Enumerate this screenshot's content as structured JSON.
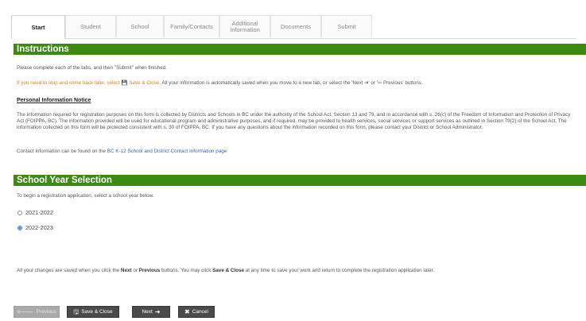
{
  "tabs": [
    {
      "label": "Start",
      "active": true
    },
    {
      "label": "Student",
      "active": false
    },
    {
      "label": "School",
      "active": false
    },
    {
      "label": "Family/Contacts",
      "active": false
    },
    {
      "label": "Additional Information",
      "active": false
    },
    {
      "label": "Documents",
      "active": false
    },
    {
      "label": "Submit",
      "active": false
    }
  ],
  "instructions": {
    "header": "Instructions",
    "line1": "Please complete each of the tabs, and then \"Submit\" when finished.",
    "line2_orange": "If you need to stop and come back later, select",
    "line2_save": "Save & Close",
    "line2_rest": ". All your information is automatically saved when you move to a new tab, or select the 'Next",
    "line2_rest2": "' or '",
    "line2_prev": "Previous' buttons.",
    "notice_title": "Personal Information Notice",
    "notice_body": "The information required for registration purposes on this form is collected by Districts and Schools in BC under the authority of the School Act, Section 13 and 79, and in accordance with s. 26(c) of the Freedom of Information and Protection of Privacy Act (FOIPPA, BC). The information provided will be used for educational program and administrative purposes, and if required, may be provided to health services, social services or support services as outlined in Section 79(2) of the School Act. The information collected on this form will be protected consistent with s. 30 of FOIPPA, BC. If you have any questions about the information recorded on this form, please contact your District or School Administrator.",
    "contact_prefix": "Contact information can be found on the",
    "contact_link": "BC K-12 School and District Contact Information page"
  },
  "school_year": {
    "header": "School Year Selection",
    "prompt": "To begin a registration application, select a school year below.",
    "options": [
      {
        "label": "2021-2022",
        "checked": false
      },
      {
        "label": "2022-2023",
        "checked": true
      }
    ]
  },
  "footer": {
    "p1": "All your changes are saved when you click the",
    "next": "Next",
    "or": "or",
    "previous": "Previous",
    "p2": "buttons. You may click",
    "save_close": "Save & Close",
    "p3": "at any time to save your work and return to complete the registration application later."
  },
  "buttons": {
    "previous": "Previous",
    "save_close": "Save & Close",
    "next": "Next",
    "cancel": "Cancel"
  },
  "colors": {
    "section_bar": "#3c8a12",
    "link": "#3a64b7",
    "orange_text": "#e0801c",
    "selected_radio": "#3f7fd1"
  }
}
